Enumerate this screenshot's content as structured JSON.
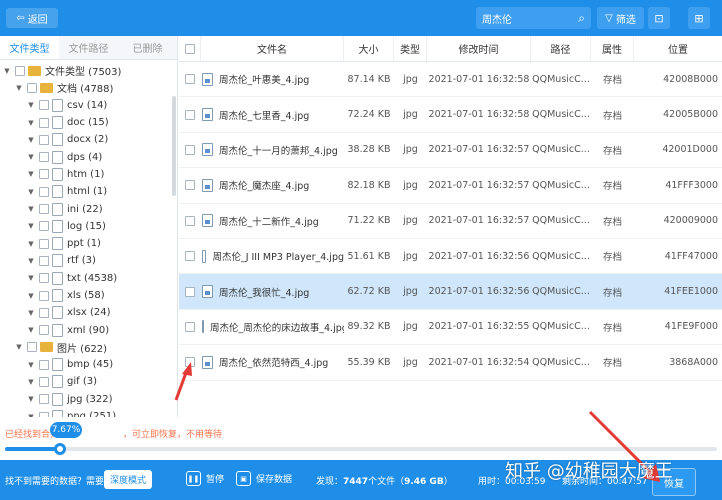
{
  "toolbar": {
    "back_label": "返回",
    "search_value": "周杰伦",
    "filter_label": "筛选"
  },
  "sidebar": {
    "tabs": [
      "文件类型",
      "文件路径",
      "已删除"
    ],
    "tree": [
      {
        "level": 0,
        "kind": "folder",
        "label": "文件类型 (7503)"
      },
      {
        "level": 1,
        "kind": "folder",
        "label": "文档 (4788)"
      },
      {
        "level": 2,
        "kind": "file",
        "label": "csv (14)"
      },
      {
        "level": 2,
        "kind": "file",
        "label": "doc (15)"
      },
      {
        "level": 2,
        "kind": "file",
        "label": "docx (2)"
      },
      {
        "level": 2,
        "kind": "file",
        "label": "dps (4)"
      },
      {
        "level": 2,
        "kind": "file",
        "label": "htm (1)"
      },
      {
        "level": 2,
        "kind": "file",
        "label": "html (1)"
      },
      {
        "level": 2,
        "kind": "file",
        "label": "ini (22)"
      },
      {
        "level": 2,
        "kind": "file",
        "label": "log (15)"
      },
      {
        "level": 2,
        "kind": "file",
        "label": "ppt (1)"
      },
      {
        "level": 2,
        "kind": "file",
        "label": "rtf (3)"
      },
      {
        "level": 2,
        "kind": "file",
        "label": "txt (4538)"
      },
      {
        "level": 2,
        "kind": "file",
        "label": "xls (58)"
      },
      {
        "level": 2,
        "kind": "file",
        "label": "xlsx (24)"
      },
      {
        "level": 2,
        "kind": "file",
        "label": "xml (90)"
      },
      {
        "level": 1,
        "kind": "folder",
        "label": "图片 (622)"
      },
      {
        "level": 2,
        "kind": "file",
        "label": "bmp (45)"
      },
      {
        "level": 2,
        "kind": "file",
        "label": "gif (3)"
      },
      {
        "level": 2,
        "kind": "file",
        "label": "jpg (322)"
      },
      {
        "level": 2,
        "kind": "file",
        "label": "png (251)"
      }
    ]
  },
  "table": {
    "columns": [
      "文件名",
      "大小",
      "类型",
      "修改时间",
      "路径",
      "属性",
      "位置"
    ],
    "rows": [
      {
        "name": "周杰伦_叶惠美_4.jpg",
        "size": "87.14 KB",
        "type": "jpg",
        "time": "2021-07-01 16:32:58",
        "path": "QQMusicC...",
        "attr": "存档",
        "pos": "42008B000",
        "selected": false
      },
      {
        "name": "周杰伦_七里香_4.jpg",
        "size": "72.24 KB",
        "type": "jpg",
        "time": "2021-07-01 16:32:58",
        "path": "QQMusicC...",
        "attr": "存档",
        "pos": "42005B000",
        "selected": false
      },
      {
        "name": "周杰伦_十一月的萧邦_4.jpg",
        "size": "38.28 KB",
        "type": "jpg",
        "time": "2021-07-01 16:32:57",
        "path": "QQMusicC...",
        "attr": "存档",
        "pos": "42001D000",
        "selected": false
      },
      {
        "name": "周杰伦_魔杰座_4.jpg",
        "size": "82.18 KB",
        "type": "jpg",
        "time": "2021-07-01 16:32:57",
        "path": "QQMusicC...",
        "attr": "存档",
        "pos": "41FFF3000",
        "selected": false
      },
      {
        "name": "周杰伦_十二新作_4.jpg",
        "size": "71.22 KB",
        "type": "jpg",
        "time": "2021-07-01 16:32:57",
        "path": "QQMusicC...",
        "attr": "存档",
        "pos": "420009000",
        "selected": false
      },
      {
        "name": "周杰伦_J III MP3 Player_4.jpg",
        "size": "51.61 KB",
        "type": "jpg",
        "time": "2021-07-01 16:32:56",
        "path": "QQMusicC...",
        "attr": "存档",
        "pos": "41FF47000",
        "selected": false
      },
      {
        "name": "周杰伦_我很忙_4.jpg",
        "size": "62.72 KB",
        "type": "jpg",
        "time": "2021-07-01 16:32:56",
        "path": "QQMusicC...",
        "attr": "存档",
        "pos": "41FEE1000",
        "selected": true
      },
      {
        "name": "周杰伦_周杰伦的床边故事_4.jpg",
        "size": "89.32 KB",
        "type": "jpg",
        "time": "2021-07-01 16:32:55",
        "path": "QQMusicC...",
        "attr": "存档",
        "pos": "41FE9F000",
        "selected": false
      },
      {
        "name": "周杰伦_依然范特西_4.jpg",
        "size": "55.39 KB",
        "type": "jpg",
        "time": "2021-07-01 16:32:54",
        "path": "QQMusicC...",
        "attr": "存档",
        "pos": "3868A000",
        "selected": false
      }
    ]
  },
  "progress": {
    "found_prefix": "已经找到合并",
    "found_suffix": "，可立即恢复，不用等待",
    "percent_label": "7.67%",
    "percent": 7.67
  },
  "bottom": {
    "help_text": "找不到需要的数据？需要",
    "deep_mode_label": "深度模式",
    "pause_label": "暂停",
    "save_label": "保存数据",
    "found_label": "发现：",
    "files_count": "7447",
    "files_unit": "个文件（",
    "files_size": "9.46 GB",
    "files_close": "）",
    "elapsed": "用时：00:03:59",
    "remaining": "剩余时间：00:47:57",
    "recover_label": "恢复"
  },
  "watermark": "知乎 @幼稚园大魔王",
  "colors": {
    "accent": "#1f8ee8",
    "selected_row": "#cfe6fb",
    "warning_text": "#f5734a",
    "annotation_arrow": "#e53935"
  }
}
